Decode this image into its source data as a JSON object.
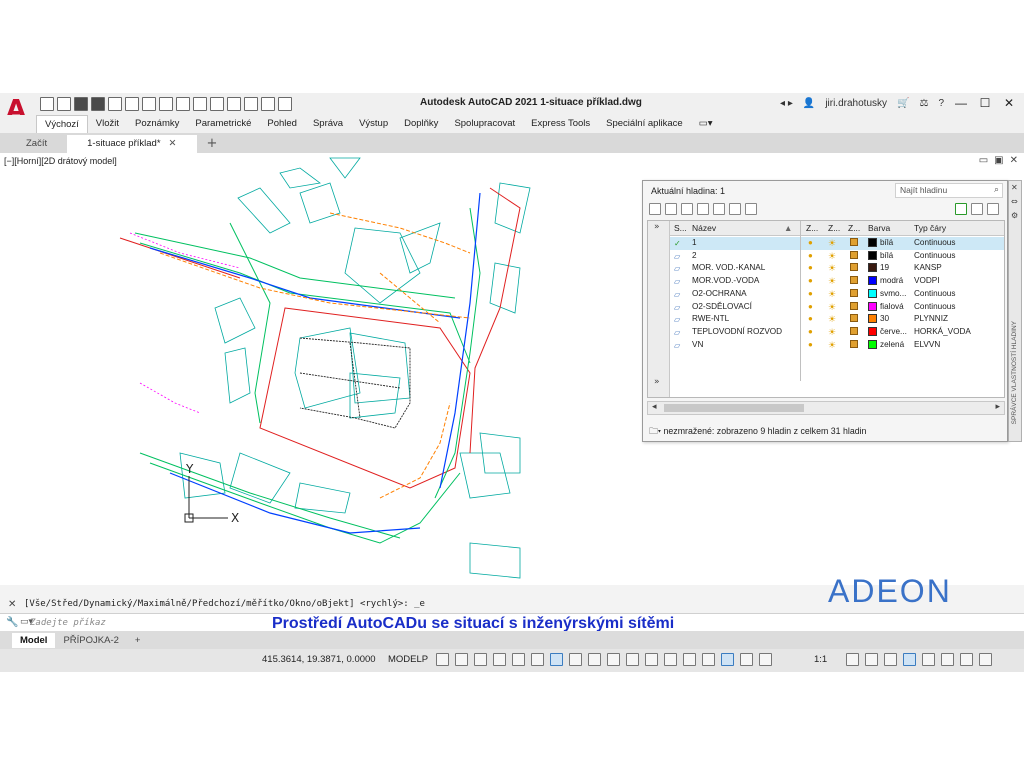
{
  "app": {
    "title": "Autodesk AutoCAD 2021   1-situace příklad.dwg",
    "user": "jiri.drahotusky",
    "logo_letter": "A"
  },
  "ribbon_tabs": [
    "Výchozí",
    "Vložit",
    "Poznámky",
    "Parametrické",
    "Pohled",
    "Správa",
    "Výstup",
    "Doplňky",
    "Spolupracovat",
    "Express Tools",
    "Speciální aplikace"
  ],
  "doc_tabs": {
    "start": "Začít",
    "active": "1-situace příklad*"
  },
  "viewport": {
    "label": "[−][Horní][2D drátový model]"
  },
  "ucs": {
    "y": "Y",
    "x": "X"
  },
  "layer_palette": {
    "current_layer": "Aktuální hladina: 1",
    "search_placeholder": "Najít hladinu",
    "columns": [
      "S...",
      "Název",
      "Z...",
      "Z...",
      "Z...",
      "Barva",
      "Typ čáry"
    ],
    "layers": [
      {
        "name": "1",
        "color_name": "bílá",
        "color": "#000000",
        "linetype": "Continuous",
        "current": true
      },
      {
        "name": "2",
        "color_name": "bílá",
        "color": "#000000",
        "linetype": "Continuous",
        "current": false
      },
      {
        "name": "MOR. VOD.-KANAL",
        "color_name": "19",
        "color": "#3a1a10",
        "linetype": "KANSP",
        "current": false
      },
      {
        "name": "MOR.VOD.-VODA",
        "color_name": "modrá",
        "color": "#0000ff",
        "linetype": "VODPI",
        "current": false
      },
      {
        "name": "O2-OCHRANA",
        "color_name": "svmo...",
        "color": "#00ffff",
        "linetype": "Continuous",
        "current": false
      },
      {
        "name": "O2-SDĚLOVACÍ",
        "color_name": "fialová",
        "color": "#ff00ff",
        "linetype": "Continuous",
        "current": false
      },
      {
        "name": "RWE-NTL",
        "color_name": "30",
        "color": "#ff8000",
        "linetype": "PLYNNIZ",
        "current": false
      },
      {
        "name": "TEPLOVODNÍ ROZVOD",
        "color_name": "červe...",
        "color": "#ff0000",
        "linetype": "HORKÁ_VODA",
        "current": false
      },
      {
        "name": "VN",
        "color_name": "zelená",
        "color": "#00ff00",
        "linetype": "ELVVN",
        "current": false
      }
    ],
    "status": "nezmražené: zobrazeno 9 hladin z celkem 31 hladin",
    "side_title": "SPRÁVCE VLASTNOSTÍ HLADINY"
  },
  "command": {
    "history": "[Vše/Střed/Dynamický/Maximálně/Předchozí/měřítko/Okno/oBjekt] <rychlý>: _e",
    "placeholder": "Zadejte příkaz"
  },
  "caption": "Prostředí AutoCADu se situací s inženýrskými sítěmi",
  "watermark": "ADEON",
  "layout_tabs": [
    "Model",
    "PŘÍPOJKA-2"
  ],
  "statusbar": {
    "coords": "415.3614, 19.3871, 0.0000",
    "mode": "MODELP",
    "scale": "1:1"
  }
}
